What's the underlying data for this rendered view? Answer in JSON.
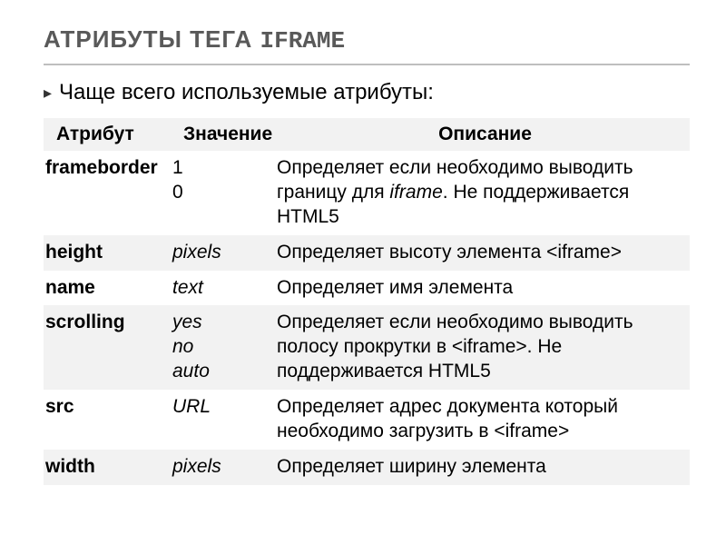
{
  "heading_prefix": "Атрибуты тега ",
  "heading_mono": "IFRAME",
  "intro": "Чаще всего используемые атрибуты:",
  "columns": {
    "c1": "Атрибут",
    "c2": "Значение",
    "c3": "Описание"
  },
  "chart_data": {
    "type": "table",
    "title": "Атрибуты тега IFRAME",
    "columns": [
      "Атрибут",
      "Значение",
      "Описание"
    ],
    "rows": [
      {
        "attr": "frameborder",
        "values": [
          "1",
          "0"
        ],
        "desc": "Определяет если необходимо выводить границу для iframe. Не поддерживается HTML5"
      },
      {
        "attr": "height",
        "values": [
          "pixels"
        ],
        "desc": "Определяет высоту элемента <iframe>"
      },
      {
        "attr": "name",
        "values": [
          "text"
        ],
        "desc": "Определяет имя элемента"
      },
      {
        "attr": "scrolling",
        "values": [
          "yes",
          "no",
          "auto"
        ],
        "desc": "Определяет если необходимо выводить полосу прокрутки в <iframe>. Не поддерживается HTML5"
      },
      {
        "attr": "src",
        "values": [
          "URL"
        ],
        "desc": "Определяет адрес документа который необходимо загрузить в <iframe>"
      },
      {
        "attr": "width",
        "values": [
          "pixels"
        ],
        "desc": "Определяет ширину элемента"
      }
    ]
  },
  "rows": {
    "r0": {
      "attr": "framebord​er",
      "val0": "1",
      "val1": "0",
      "desc_a": "Определяет если необходимо выводить границу для ",
      "desc_b": "iframe",
      "desc_c": ". Не поддерживается HTML5"
    },
    "r1": {
      "attr": "height",
      "val0": "pixels",
      "desc": "Определяет высоту элемента <iframe>"
    },
    "r2": {
      "attr": "name",
      "val0": "text",
      "desc": "Определяет имя элемента"
    },
    "r3": {
      "attr": "scrolling",
      "val0": "yes",
      "val1": "no",
      "val2": "auto",
      "desc": "Определяет если необходимо выводить полосу прокрутки в <iframe>. Не поддерживается HTML5"
    },
    "r4": {
      "attr": "src",
      "val0": "URL",
      "desc": "Определяет адрес документа который необходимо загрузить в <iframe>"
    },
    "r5": {
      "attr": "width",
      "val0": "pixels",
      "desc": "Определяет ширину элемента"
    }
  }
}
